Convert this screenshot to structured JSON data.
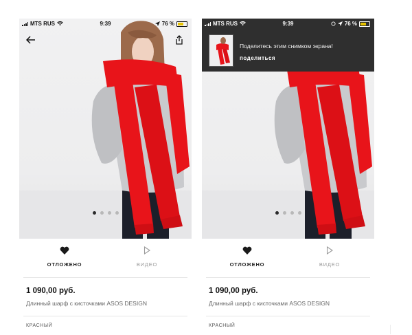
{
  "status_bar": {
    "carrier": "MTS RUS",
    "time": "9:39",
    "battery": "76 %",
    "battery_level": 0.76
  },
  "product": {
    "price": "1 090,00 руб.",
    "description": "Длинный шарф с кисточками ASOS DESIGN",
    "cutoff_text": "КРАСНЫЙ"
  },
  "actions": {
    "saved_label": "ОТЛОЖЕНО",
    "video_label": "ВИДЕО"
  },
  "carousel": {
    "count": 4,
    "active_index": 0
  },
  "share_banner": {
    "message": "Поделитесь этим снимком экрана!",
    "button_label": "поделиться"
  },
  "icons": {
    "back": "back-arrow-icon",
    "share": "share-icon",
    "saved": "heart-icon",
    "video": "play-icon",
    "wifi": "wifi-icon",
    "location": "location-arrow-icon",
    "alarm": "alarm-icon"
  },
  "colors": {
    "scarf_red": "#e8141a",
    "banner_bg": "#2f2f2f",
    "accent_text": "#111111",
    "battery_fill": "#e7c300"
  }
}
